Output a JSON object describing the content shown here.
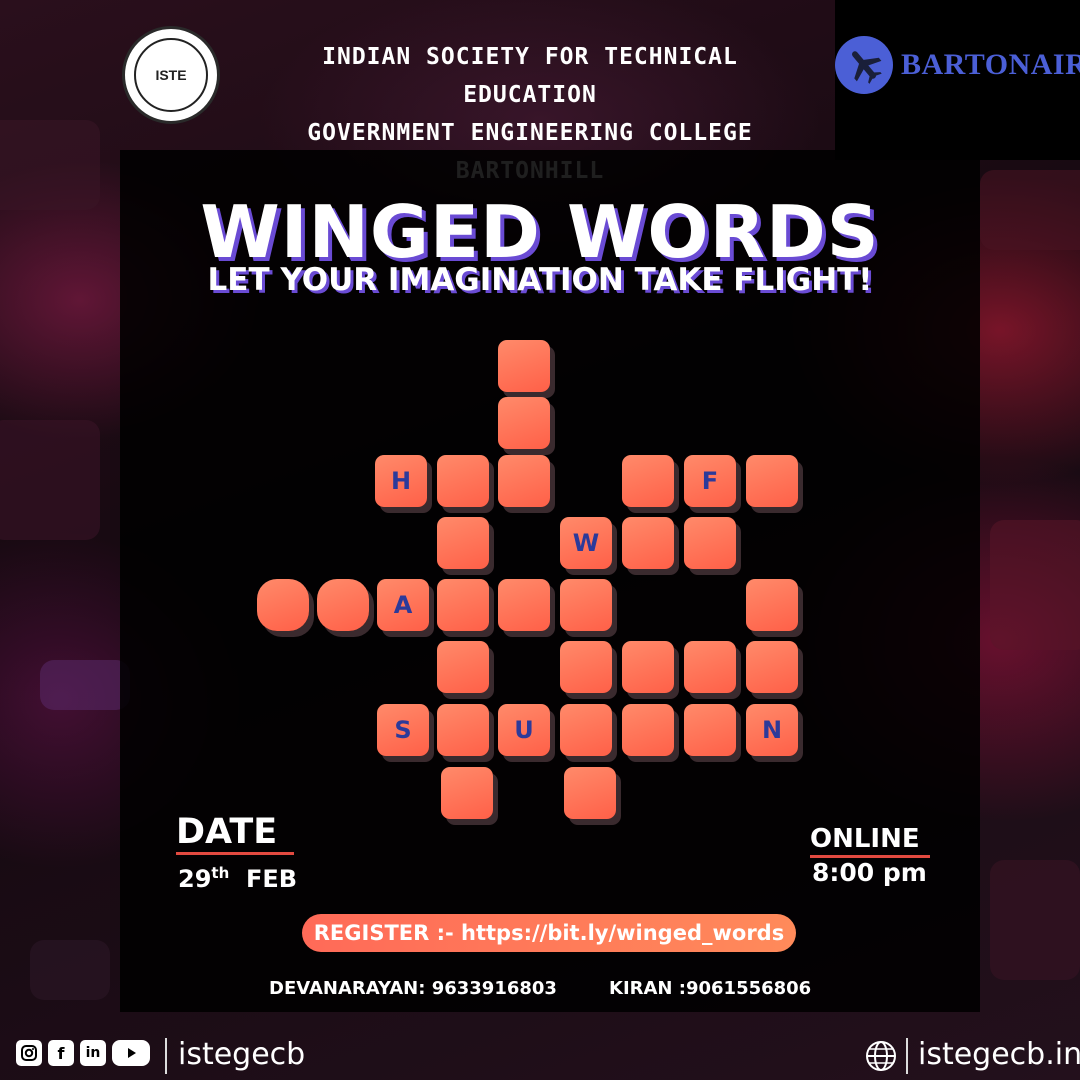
{
  "header": {
    "org_line1": "INDIAN SOCIETY FOR TECHNICAL EDUCATION",
    "org_line2": "GOVERNMENT ENGINEERING COLLEGE BARTONHILL",
    "iste_logo_text": "ISTE",
    "sponsor_name": "BARTONAIR"
  },
  "event": {
    "title": "WINGED WORDS",
    "tagline": "LET YOUR IMAGINATION TAKE FLIGHT!"
  },
  "crossword": {
    "letters": {
      "H": "H",
      "F": "F",
      "W": "W",
      "A": "A",
      "S": "S",
      "U": "U",
      "N": "N"
    }
  },
  "date": {
    "heading": "DATE",
    "day": "29",
    "suffix": "th",
    "month": "FEB"
  },
  "mode": {
    "heading": "ONLINE",
    "time": "8:00 pm"
  },
  "register": {
    "text": "REGISTER :- https://bit.ly/winged_words"
  },
  "contacts": [
    {
      "text": "DEVANARAYAN: 9633916803"
    },
    {
      "text": "KIRAN :9061556806"
    }
  ],
  "footer": {
    "social_handle": "istegecb",
    "website": "istegecb.in",
    "icons": [
      "instagram-icon",
      "facebook-icon",
      "linkedin-icon",
      "youtube-icon",
      "globe-icon"
    ]
  },
  "colors": {
    "tile": "#ff7458",
    "letter": "#2c3a9a",
    "accent_line": "#e24a40",
    "shadow_purple": "#6a4bd4",
    "sponsor_blue": "#4b5fd6"
  }
}
